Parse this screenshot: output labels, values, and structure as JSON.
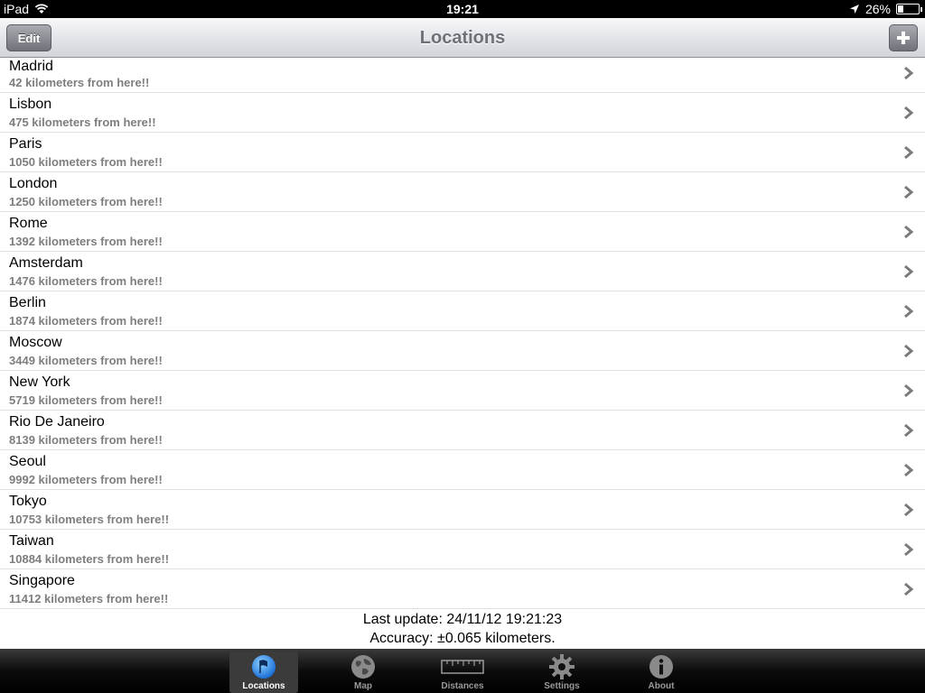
{
  "status_bar": {
    "device": "iPad",
    "time": "19:21",
    "battery": "26%",
    "battery_level": 0.26
  },
  "nav": {
    "title": "Locations",
    "edit_label": "Edit",
    "add_label": "+"
  },
  "locations": [
    {
      "name": "Madrid",
      "distance": "42 kilometers from here!!"
    },
    {
      "name": "Lisbon",
      "distance": "475 kilometers from here!!"
    },
    {
      "name": "Paris",
      "distance": "1050 kilometers from here!!"
    },
    {
      "name": "London",
      "distance": "1250 kilometers from here!!"
    },
    {
      "name": "Rome",
      "distance": "1392 kilometers from here!!"
    },
    {
      "name": "Amsterdam",
      "distance": "1476 kilometers from here!!"
    },
    {
      "name": "Berlin",
      "distance": "1874 kilometers from here!!"
    },
    {
      "name": "Moscow",
      "distance": "3449 kilometers from here!!"
    },
    {
      "name": "New York",
      "distance": "5719 kilometers from here!!"
    },
    {
      "name": "Rio De Janeiro",
      "distance": "8139 kilometers from here!!"
    },
    {
      "name": "Seoul",
      "distance": "9992 kilometers from here!!"
    },
    {
      "name": "Tokyo",
      "distance": "10753 kilometers from here!!"
    },
    {
      "name": "Taiwan",
      "distance": "10884 kilometers from here!!"
    },
    {
      "name": "Singapore",
      "distance": "11412 kilometers from here!!"
    }
  ],
  "footer": {
    "last_update": "Last update: 24/11/12 19:21:23",
    "accuracy": "Accuracy: ±0.065 kilometers."
  },
  "tabs": [
    {
      "label": "Locations",
      "icon": "flag-globe-icon",
      "active": true
    },
    {
      "label": "Map",
      "icon": "globe-icon",
      "active": false
    },
    {
      "label": "Distances",
      "icon": "ruler-icon",
      "active": false
    },
    {
      "label": "Settings",
      "icon": "gear-icon",
      "active": false
    },
    {
      "label": "About",
      "icon": "info-icon",
      "active": false
    }
  ],
  "colors": {
    "accent_blue": "#2f8ff0",
    "subtitle_gray": "#7e7e7e",
    "nav_title_gray": "#6e7176"
  }
}
